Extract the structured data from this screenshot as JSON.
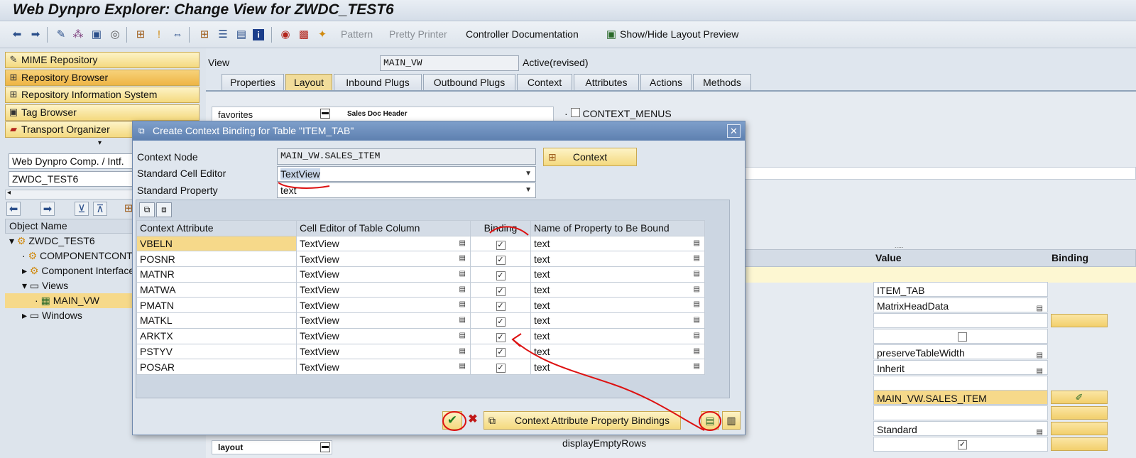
{
  "window": {
    "title": "Web Dynpro Explorer: Change View for ZWDC_TEST6"
  },
  "toolbar": {
    "pattern": "Pattern",
    "pretty_printer": "Pretty Printer",
    "controller_doc": "Controller Documentation",
    "show_hide_layout": "Show/Hide Layout Preview"
  },
  "navigator": {
    "buttons": [
      {
        "label": "MIME Repository",
        "icon": "mime-icon"
      },
      {
        "label": "Repository Browser",
        "icon": "repository-icon"
      },
      {
        "label": "Repository Information System",
        "icon": "info-system-icon"
      },
      {
        "label": "Tag Browser",
        "icon": "tag-icon"
      },
      {
        "label": "Transport Organizer",
        "icon": "truck-icon"
      }
    ],
    "object_type": "Web Dynpro Comp. / Intf.",
    "object_name": "ZWDC_TEST6",
    "tree_header": "Object Name",
    "tree": [
      {
        "label": "ZWDC_TEST6",
        "level": 0
      },
      {
        "label": "COMPONENTCONTROLLER",
        "level": 1
      },
      {
        "label": "Component Interface",
        "level": 1
      },
      {
        "label": "Views",
        "level": 1
      },
      {
        "label": "MAIN_VW",
        "level": 2
      },
      {
        "label": "Windows",
        "level": 1
      }
    ]
  },
  "view": {
    "label": "View",
    "name": "MAIN_VW",
    "status": "Active(revised)",
    "tabs": [
      "Properties",
      "Layout",
      "Inbound Plugs",
      "Outbound Plugs",
      "Context",
      "Attributes",
      "Actions",
      "Methods"
    ],
    "active_tab": "Layout",
    "ui_tree_items": [
      "favorites",
      "Sales Doc Header",
      "layout"
    ],
    "context_menus": "CONTEXT_MENUS",
    "display_empty_rows": "displayEmptyRows"
  },
  "properties": {
    "col_value": "Value",
    "col_binding": "Binding",
    "rows": [
      "ITEM_TAB",
      "MatrixHeadData",
      "",
      "",
      "preserveTableWidth",
      "Inherit",
      "",
      "MAIN_VW.SALES_ITEM",
      "",
      "Standard",
      ""
    ]
  },
  "dialog": {
    "title": "Create Context Binding for Table \"ITEM_TAB\"",
    "context_node_label": "Context Node",
    "context_node_value": "MAIN_VW.SALES_ITEM",
    "context_button": "Context",
    "cell_editor_label": "Standard Cell Editor",
    "cell_editor_value": "TextView",
    "std_property_label": "Standard Property",
    "std_property_value": "text",
    "columns": [
      "Context Attribute",
      "Cell Editor of Table Column",
      "Binding",
      "Name of Property to Be Bound"
    ],
    "rows": [
      {
        "attr": "VBELN",
        "editor": "TextView",
        "prop": "text"
      },
      {
        "attr": "POSNR",
        "editor": "TextView",
        "prop": "text"
      },
      {
        "attr": "MATNR",
        "editor": "TextView",
        "prop": "text"
      },
      {
        "attr": "MATWA",
        "editor": "TextView",
        "prop": "text"
      },
      {
        "attr": "PMATN",
        "editor": "TextView",
        "prop": "text"
      },
      {
        "attr": "MATKL",
        "editor": "TextView",
        "prop": "text"
      },
      {
        "attr": "ARKTX",
        "editor": "TextView",
        "prop": "text"
      },
      {
        "attr": "PSTYV",
        "editor": "TextView",
        "prop": "text"
      },
      {
        "attr": "POSAR",
        "editor": "TextView",
        "prop": "text"
      }
    ],
    "property_bindings_button": "Context Attribute Property Bindings"
  }
}
